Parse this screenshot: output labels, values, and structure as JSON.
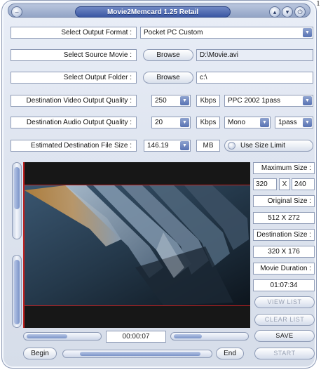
{
  "window": {
    "title": "Movie2Memcard 1.25 Retail",
    "corner_label": "1"
  },
  "titlebar_icons": [
    "menu-icon",
    "scroll-up-icon",
    "scroll-down-icon",
    "power-icon"
  ],
  "output_format": {
    "label": "Select Output Format :",
    "value": "Pocket PC Custom"
  },
  "source_movie": {
    "label": "Select Source Movie :",
    "browse": "Browse",
    "value": "D:\\Movie.avi"
  },
  "output_folder": {
    "label": "Select Output Folder :",
    "browse": "Browse",
    "value": "c:\\"
  },
  "video_quality": {
    "label": "Destination Video Output Quality :",
    "value": "250",
    "unit": "Kbps",
    "profile": "PPC 2002 1pass"
  },
  "audio_quality": {
    "label": "Destination Audio Output Quality :",
    "value": "20",
    "unit": "Kbps",
    "channels": "Mono",
    "pass": "1pass"
  },
  "file_size": {
    "label": "Estimated Destination File Size :",
    "value": "146.19",
    "unit": "MB",
    "limit_label": "Use Size Limit"
  },
  "info": {
    "max_size_label": "Maximum Size :",
    "max_w": "320",
    "x": "X",
    "max_h": "240",
    "orig_size_label": "Original Size :",
    "orig_size": "512 X 272",
    "dest_size_label": "Destination Size :",
    "dest_size": "320 X 176",
    "duration_label": "Movie Duration :",
    "duration": "01:07:34"
  },
  "buttons": {
    "view_list": "VIEW LIST",
    "clear_list": "CLEAR LIST",
    "save": "SAVE",
    "start": "START",
    "begin": "Begin",
    "end": "End"
  },
  "playback": {
    "time": "00:00:07"
  }
}
